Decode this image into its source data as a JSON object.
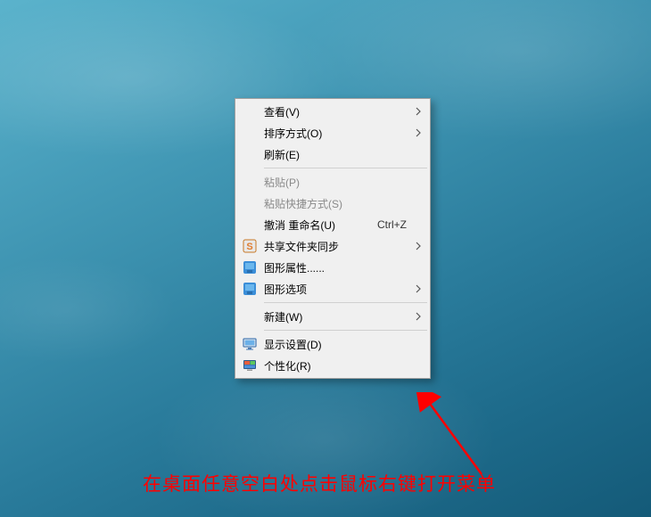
{
  "menu": {
    "items": [
      {
        "label": "查看(V)",
        "has_submenu": true
      },
      {
        "label": "排序方式(O)",
        "has_submenu": true
      },
      {
        "label": "刷新(E)"
      }
    ],
    "items2": [
      {
        "label": "粘贴(P)",
        "disabled": true
      },
      {
        "label": "粘贴快捷方式(S)",
        "disabled": true
      },
      {
        "label": "撤消 重命名(U)",
        "shortcut": "Ctrl+Z"
      },
      {
        "label": "共享文件夹同步",
        "has_submenu": true,
        "icon": "s-orange"
      },
      {
        "label": "图形属性......",
        "icon": "blue-box"
      },
      {
        "label": "图形选项",
        "has_submenu": true,
        "icon": "blue-box"
      }
    ],
    "items3": [
      {
        "label": "新建(W)",
        "has_submenu": true
      }
    ],
    "items4": [
      {
        "label": "显示设置(D)",
        "icon": "monitor"
      },
      {
        "label": "个性化(R)",
        "icon": "personalize"
      }
    ]
  },
  "annotation": {
    "text": "在桌面任意空白处点击鼠标右键打开菜单"
  }
}
